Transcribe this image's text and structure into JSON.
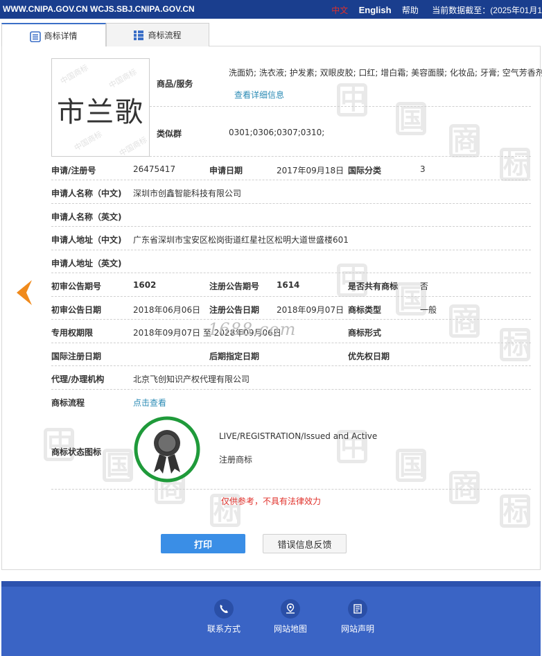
{
  "topbar": {
    "site": "WWW.CNIPA.GOV.CN WCJS.SBJ.CNIPA.GOV.CN",
    "lang_zh": "中文",
    "lang_en": "English",
    "help": "帮助",
    "update_label": "当前数据截至：(2025年01月1"
  },
  "tabs": [
    {
      "label": "商标详情",
      "icon": "document-list-icon"
    },
    {
      "label": "商标流程",
      "icon": "grid-list-icon"
    }
  ],
  "trademark": {
    "image_text": "市兰歌",
    "goods_label": "商品/服务",
    "goods_value": "洗面奶; 洗衣液; 护发素; 双眼皮胶; 口红; 增白霜; 美容面膜; 化妆品; 牙膏; 空气芳香剂",
    "goods_link": "查看详细信息",
    "similar_label": "类似群",
    "similar_value": "0301;0306;0307;0310;"
  },
  "details": {
    "reg_no_label": "申请/注册号",
    "reg_no": "26475417",
    "apply_date_label": "申请日期",
    "apply_date": "2017年09月18日",
    "intl_class_label": "国际分类",
    "intl_class": "3",
    "applicant_cn_label": "申请人名称（中文)",
    "applicant_cn": "深圳市创鑫智能科技有限公司",
    "applicant_en_label": "申请人名称（英文)",
    "applicant_en": "",
    "address_cn_label": "申请人地址（中文)",
    "address_cn": "广东省深圳市宝安区松岗街道红星社区松明大道世盛楼601",
    "address_en_label": "申请人地址（英文)",
    "address_en": "",
    "prelim_no_label": "初审公告期号",
    "prelim_no": "1602",
    "reg_pub_no_label": "注册公告期号",
    "reg_pub_no": "1614",
    "shared_label": "是否共有商标",
    "shared": "否",
    "prelim_date_label": "初审公告日期",
    "prelim_date": "2018年06月06日",
    "reg_pub_date_label": "注册公告日期",
    "reg_pub_date": "2018年09月07日",
    "tm_type_label": "商标类型",
    "tm_type": "一般",
    "exclusive_label": "专用权期限",
    "exclusive": "2018年09月07日 至 2028年09月06日",
    "tm_form_label": "商标形式",
    "tm_form": "",
    "intl_reg_date_label": "国际注册日期",
    "intl_reg_date": "",
    "later_date_label": "后期指定日期",
    "later_date": "",
    "priority_date_label": "优先权日期",
    "priority_date": "",
    "agent_label": "代理/办理机构",
    "agent": "北京飞创知识产权代理有限公司",
    "process_label": "商标流程",
    "process_link": "点击查看",
    "status_label": "商标状态图标",
    "status_en": "LIVE/REGISTRATION/Issued and Active",
    "status_cn": "注册商标"
  },
  "watermark_text": "1688.com",
  "disclaimer": "仅供参考，不具有法律效力",
  "buttons": {
    "print": "打印",
    "feedback": "错误信息反馈"
  },
  "footer": [
    {
      "label": "联系方式",
      "icon": "phone-icon"
    },
    {
      "label": "网站地图",
      "icon": "map-pin-icon"
    },
    {
      "label": "网站声明",
      "icon": "document-icon"
    }
  ],
  "colors": {
    "topbar": "#1a3e8e",
    "accent": "#3a8ee6",
    "link": "#2b8bb5",
    "warning": "#e0302a",
    "badge_ring": "#1f9a3a",
    "footer": "#3a64c5"
  }
}
